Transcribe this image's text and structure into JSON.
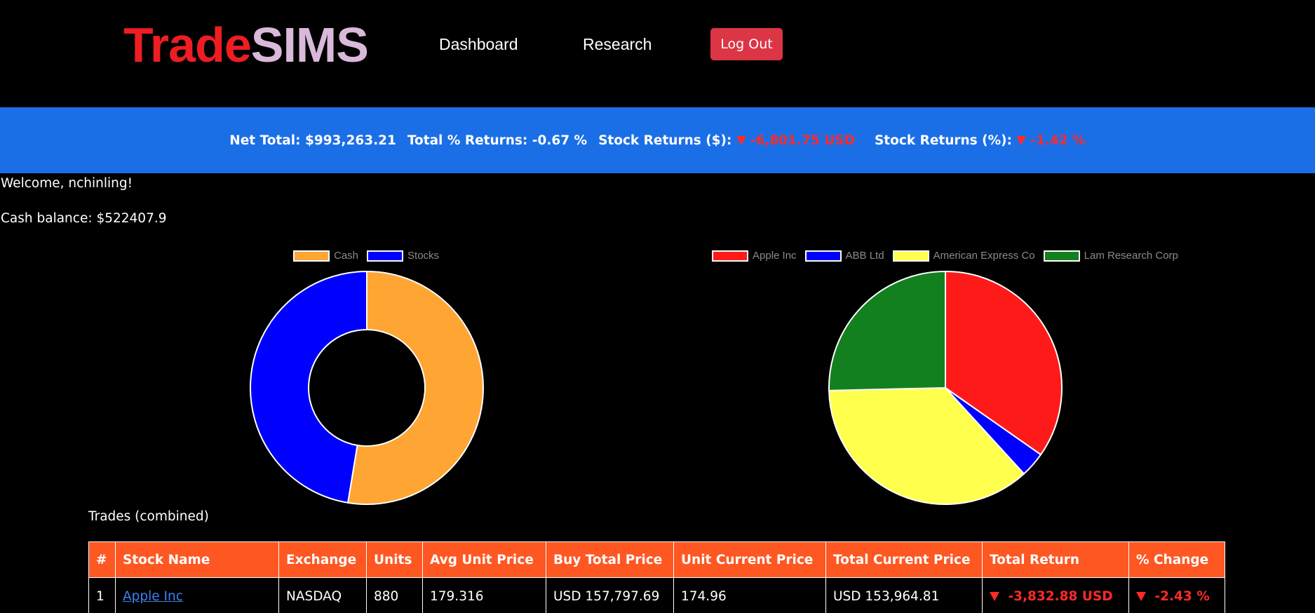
{
  "header": {
    "logo_part1": "Trade",
    "logo_part2": "SIMS",
    "nav": {
      "dashboard": "Dashboard",
      "research": "Research"
    },
    "logout_label": "Log Out"
  },
  "banner": {
    "net_total": "Net Total: $993,263.21",
    "total_returns": "Total % Returns: -0.67 %",
    "stock_returns_usd_label": "Stock Returns ($):",
    "stock_returns_usd_value": "-6,801.75 USD",
    "stock_returns_pct_label": "Stock Returns (%):",
    "stock_returns_pct_value": "-1.42 %"
  },
  "welcome": "Welcome, nchinling!",
  "cash_balance": "Cash balance: $522407.9",
  "chart_data": [
    {
      "type": "pie",
      "variant": "doughnut",
      "categories": [
        "Cash",
        "Stocks"
      ],
      "values": [
        522407.9,
        470855.31
      ],
      "colors": [
        "#ffa534",
        "#0000ff"
      ],
      "legend": "top"
    },
    {
      "type": "pie",
      "categories": [
        "Apple Inc",
        "ABB Ltd",
        "American Express Co",
        "Lam Research Corp"
      ],
      "values": [
        153964.81,
        15500,
        161500,
        112500
      ],
      "colors": [
        "#ff1a1a",
        "#0000ff",
        "#ffff4d",
        "#138020"
      ],
      "legend": "top"
    }
  ],
  "trades": {
    "title": "Trades (combined)",
    "columns": [
      "#",
      "Stock Name",
      "Exchange",
      "Units",
      "Avg Unit Price",
      "Buy Total Price",
      "Unit Current Price",
      "Total Current Price",
      "Total Return",
      "% Change"
    ],
    "rows": [
      {
        "num": "1",
        "name": "Apple Inc",
        "exchange": "NASDAQ",
        "units": "880",
        "avg_unit_price": "179.316",
        "buy_total_price": "USD 157,797.69",
        "unit_current_price": "174.96",
        "total_current_price": "USD 153,964.81",
        "total_return": "-3,832.88 USD",
        "pct_change": "-2.43 %"
      }
    ]
  },
  "colors": {
    "header_bg": "#000000",
    "banner_bg": "#1b6fe6",
    "logo_trade": "#ee1d24",
    "logo_sims": "#d9b9d9",
    "logout_bg": "#dc3545",
    "table_header_bg": "#ff5722",
    "negative": "#ff2a2a"
  }
}
